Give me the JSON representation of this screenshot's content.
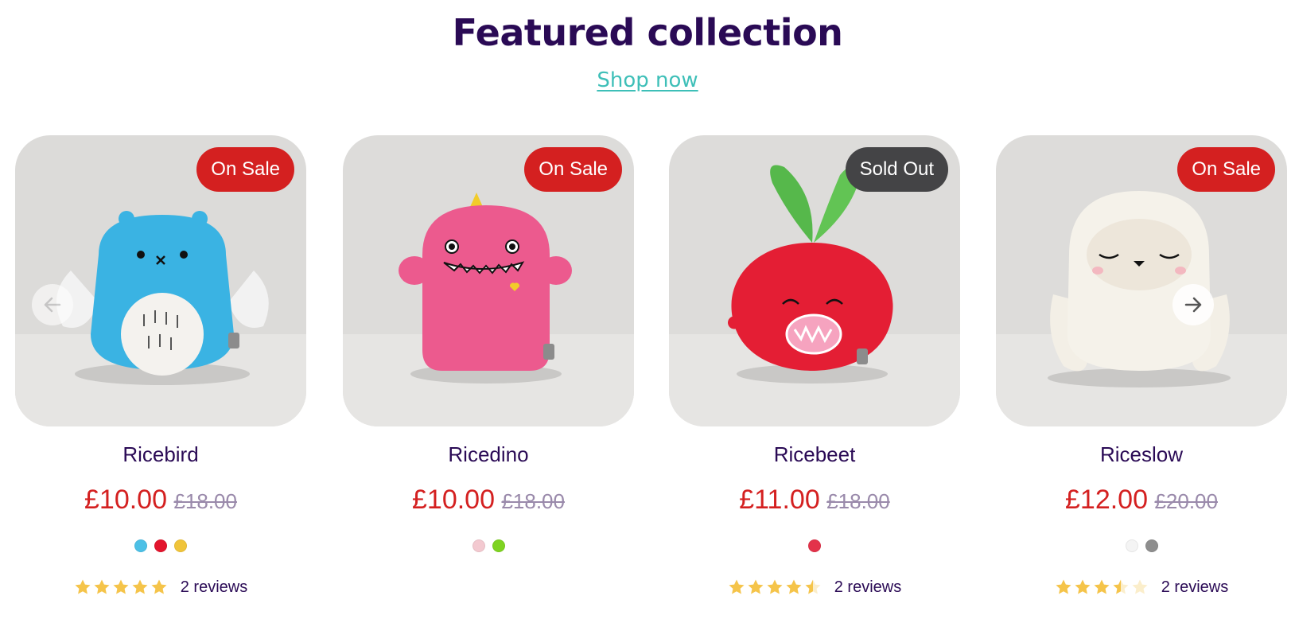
{
  "section": {
    "title": "Featured collection",
    "link_label": "Shop now"
  },
  "colors": {
    "title": "#2a0a55",
    "link": "#3ebfb8",
    "sale_badge": "#d42020",
    "sold_badge": "#444446",
    "price": "#d42020",
    "compare_price": "#9a8aab",
    "star": "#f5c44a"
  },
  "carousel": {
    "prev_icon": "arrow-left-icon",
    "next_icon": "arrow-right-icon"
  },
  "products": [
    {
      "name": "Ricebird",
      "badge": "On Sale",
      "price": "£10.00",
      "compare_price": "£18.00",
      "swatches": [
        "#4cc0e6",
        "#e3152d",
        "#f0c43a"
      ],
      "rating": 5,
      "reviews": "2 reviews"
    },
    {
      "name": "Ricedino",
      "badge": "On Sale",
      "price": "£10.00",
      "compare_price": "£18.00",
      "swatches": [
        "#f3c9d0",
        "#7ed321"
      ]
    },
    {
      "name": "Ricebeet",
      "badge": "Sold Out",
      "price": "£11.00",
      "compare_price": "£18.00",
      "swatches": [
        "#e3324a"
      ],
      "rating": 4.5,
      "reviews": "2 reviews"
    },
    {
      "name": "Riceslow",
      "badge": "On Sale",
      "price": "£12.00",
      "compare_price": "£20.00",
      "swatches": [
        "#f4f4f4",
        "#8e8e8e"
      ],
      "rating": 3.5,
      "reviews": "2 reviews"
    }
  ]
}
